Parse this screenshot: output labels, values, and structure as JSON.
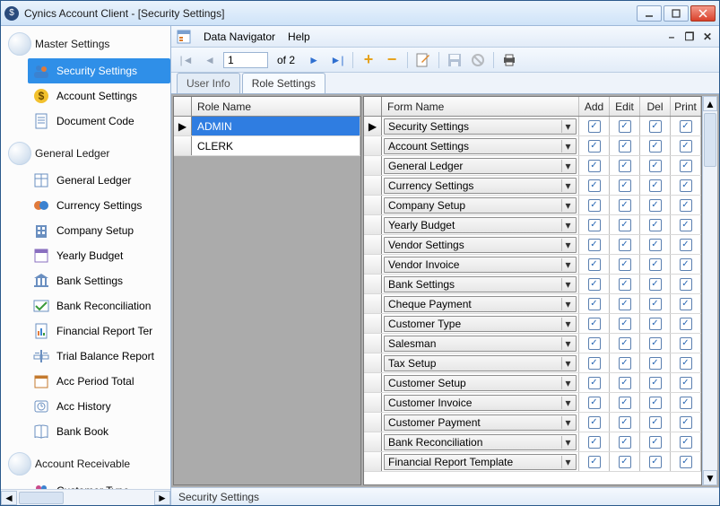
{
  "window": {
    "title": "Cynics Account Client - [Security Settings]"
  },
  "nav": {
    "groups": [
      {
        "label": "Master Settings",
        "items": [
          {
            "label": "Security Settings",
            "icon": "users-icon",
            "selected": true
          },
          {
            "label": "Account Settings",
            "icon": "dollar-icon"
          },
          {
            "label": "Document Code",
            "icon": "doc-icon"
          }
        ]
      },
      {
        "label": "General Ledger",
        "items": [
          {
            "label": "General Ledger",
            "icon": "ledger-icon"
          },
          {
            "label": "Currency Settings",
            "icon": "currency-icon"
          },
          {
            "label": "Company Setup",
            "icon": "company-icon"
          },
          {
            "label": "Yearly Budget",
            "icon": "budget-icon"
          },
          {
            "label": "Bank Settings",
            "icon": "bank-icon"
          },
          {
            "label": "Bank Reconciliation",
            "icon": "reconcile-icon"
          },
          {
            "label": "Financial Report Ter",
            "icon": "report-icon"
          },
          {
            "label": "Trial Balance Report",
            "icon": "trial-icon"
          },
          {
            "label": "Acc Period Total",
            "icon": "period-icon"
          },
          {
            "label": "Acc History",
            "icon": "history-icon"
          },
          {
            "label": "Bank Book",
            "icon": "book-icon"
          }
        ]
      },
      {
        "label": "Account Receivable",
        "items": [
          {
            "label": "Customer Type",
            "icon": "customer-icon"
          }
        ]
      }
    ]
  },
  "menu": {
    "data_navigator": "Data Navigator",
    "help": "Help"
  },
  "pager": {
    "pos": "1",
    "of_label": "of 2"
  },
  "tabs": {
    "user_info": "User Info",
    "role_settings": "Role Settings",
    "active": "role_settings"
  },
  "roles": {
    "header": "Role Name",
    "rows": [
      {
        "name": "ADMIN",
        "selected": true
      },
      {
        "name": "CLERK"
      }
    ]
  },
  "perms": {
    "headers": {
      "form": "Form Name",
      "add": "Add",
      "edit": "Edit",
      "del": "Del",
      "print": "Print"
    },
    "rows": [
      {
        "form": "Security Settings",
        "add": true,
        "edit": true,
        "del": true,
        "print": true,
        "current": true
      },
      {
        "form": "Account Settings",
        "add": true,
        "edit": true,
        "del": true,
        "print": true
      },
      {
        "form": "General Ledger",
        "add": true,
        "edit": true,
        "del": true,
        "print": true
      },
      {
        "form": "Currency Settings",
        "add": true,
        "edit": true,
        "del": true,
        "print": true
      },
      {
        "form": "Company Setup",
        "add": true,
        "edit": true,
        "del": true,
        "print": true
      },
      {
        "form": "Yearly Budget",
        "add": true,
        "edit": true,
        "del": true,
        "print": true
      },
      {
        "form": "Vendor Settings",
        "add": true,
        "edit": true,
        "del": true,
        "print": true
      },
      {
        "form": "Vendor Invoice",
        "add": true,
        "edit": true,
        "del": true,
        "print": true
      },
      {
        "form": "Bank Settings",
        "add": true,
        "edit": true,
        "del": true,
        "print": true
      },
      {
        "form": "Cheque Payment",
        "add": true,
        "edit": true,
        "del": true,
        "print": true
      },
      {
        "form": "Customer Type",
        "add": true,
        "edit": true,
        "del": true,
        "print": true
      },
      {
        "form": "Salesman",
        "add": true,
        "edit": true,
        "del": true,
        "print": true
      },
      {
        "form": "Tax Setup",
        "add": true,
        "edit": true,
        "del": true,
        "print": true
      },
      {
        "form": "Customer Setup",
        "add": true,
        "edit": true,
        "del": true,
        "print": true
      },
      {
        "form": "Customer Invoice",
        "add": true,
        "edit": true,
        "del": true,
        "print": true
      },
      {
        "form": "Customer Payment",
        "add": true,
        "edit": true,
        "del": true,
        "print": true
      },
      {
        "form": "Bank Reconciliation",
        "add": true,
        "edit": true,
        "del": true,
        "print": true
      },
      {
        "form": "Financial Report Template",
        "add": true,
        "edit": true,
        "del": true,
        "print": true
      }
    ]
  },
  "status": {
    "text": "Security Settings"
  }
}
